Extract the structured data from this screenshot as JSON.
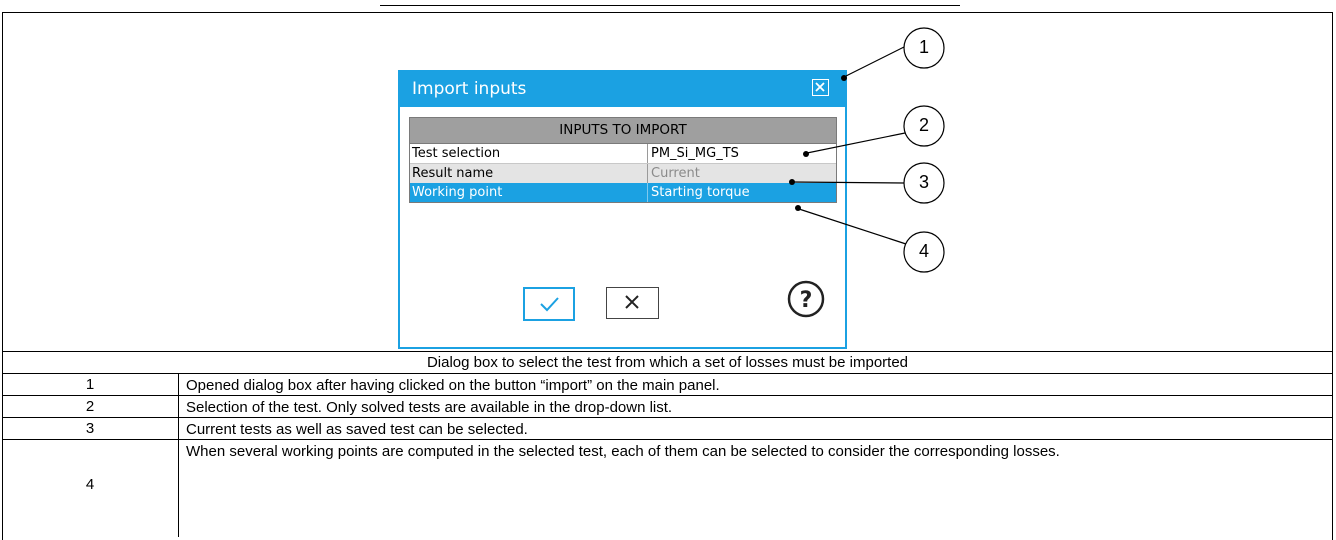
{
  "dialog": {
    "title": "Import inputs",
    "grid_header": "INPUTS TO IMPORT",
    "rows": [
      {
        "label": "Test selection",
        "value": "PM_Si_MG_TS"
      },
      {
        "label": "Result name",
        "value": "Current"
      },
      {
        "label": "Working point",
        "value": "Starting torque"
      }
    ],
    "icons": {
      "close": "close-icon",
      "ok": "checkmark-icon",
      "cancel": "cross-icon",
      "help": "help-icon"
    },
    "colors": {
      "accent": "#1ba1e2",
      "header": "#9f9f9f"
    }
  },
  "callouts": [
    "1",
    "2",
    "3",
    "4"
  ],
  "caption": "Dialog box to select the test from which a set of losses must be imported",
  "legend": [
    {
      "num": "1",
      "text": "Opened dialog box after having clicked on the button “import” on the main panel."
    },
    {
      "num": "2",
      "text": "Selection of the test. Only solved tests are available in the drop-down list."
    },
    {
      "num": "3",
      "text": "Current tests as well as saved test can be selected."
    },
    {
      "num": "4",
      "text": "When several working points are computed in the selected test, each of them can be selected to consider the corresponding losses."
    }
  ]
}
